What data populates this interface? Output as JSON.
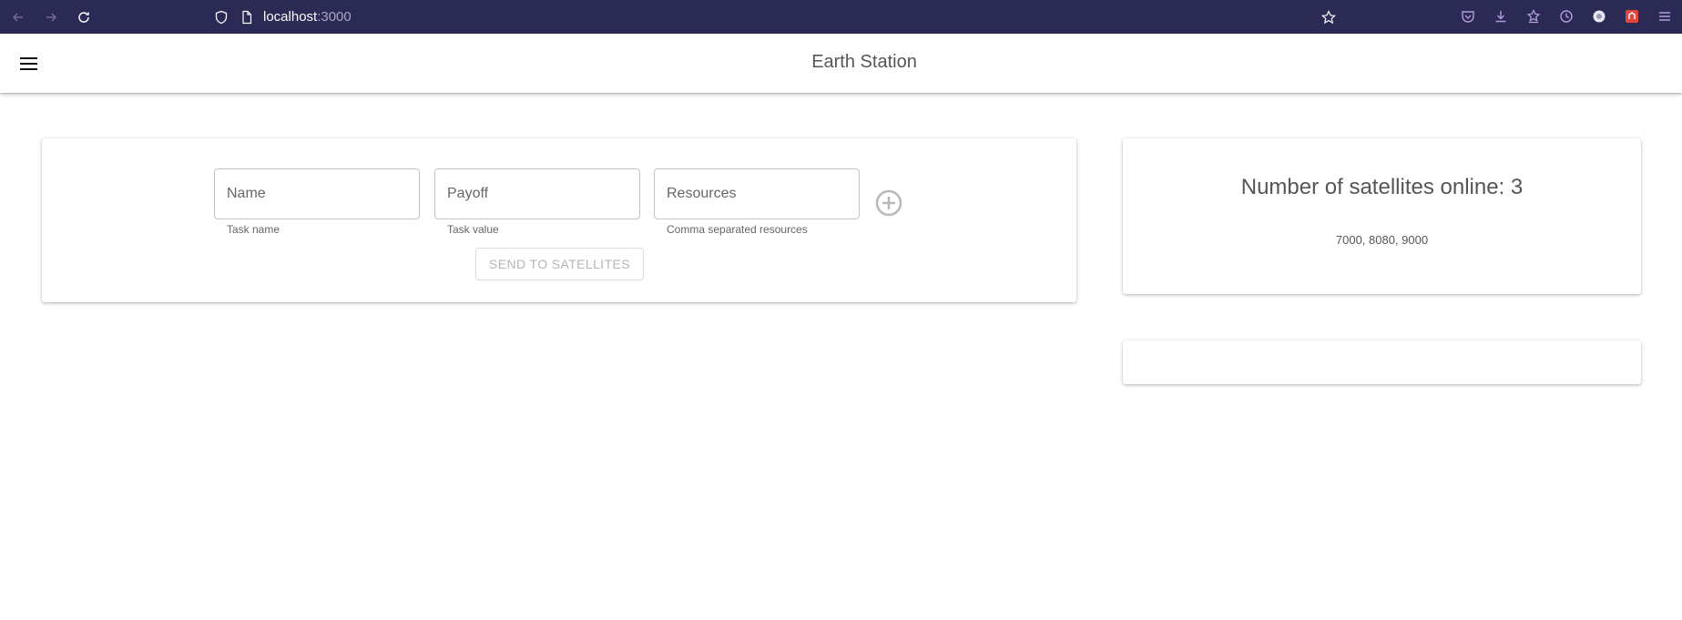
{
  "browser": {
    "url_host": "localhost",
    "url_port": ":3000"
  },
  "app": {
    "title": "Earth Station"
  },
  "task_form": {
    "name_placeholder": "Name",
    "name_helper": "Task name",
    "payoff_placeholder": "Payoff",
    "payoff_helper": "Task value",
    "resources_placeholder": "Resources",
    "resources_helper": "Comma separated resources",
    "send_label": "SEND TO SATELLITES"
  },
  "satellites": {
    "title": "Number of satellites online: 3",
    "ports": "7000, 8080, 9000"
  },
  "colors": {
    "browser_bar": "#2b2a55",
    "accent_icon": "#b19cd9"
  }
}
